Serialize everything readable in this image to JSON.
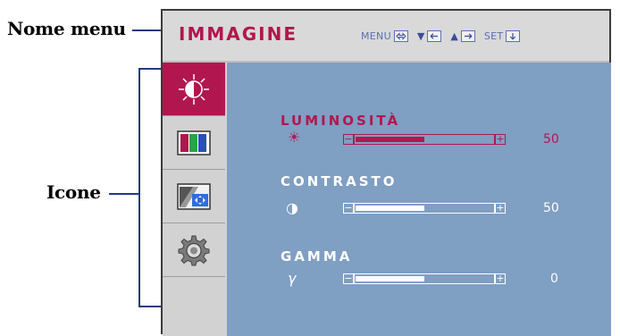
{
  "callouts": {
    "menu_name": "Nome menu",
    "icons": "Icone"
  },
  "header": {
    "title": "IMMAGINE",
    "hints": [
      {
        "label": "MENU",
        "key_icon": "menu-key-icon"
      },
      {
        "label": "",
        "symbol": "▼",
        "key_icon": "left-arrow-key-icon"
      },
      {
        "label": "",
        "symbol": "▲",
        "key_icon": "right-arrow-key-icon"
      },
      {
        "label": "SET",
        "key_icon": "down-arrow-key-icon"
      }
    ]
  },
  "sidebar": {
    "items": [
      {
        "icon": "brightness-contrast-icon",
        "active": true
      },
      {
        "icon": "color-bars-icon",
        "active": false
      },
      {
        "icon": "picture-position-icon",
        "active": false
      },
      {
        "icon": "gear-icon",
        "active": false
      }
    ]
  },
  "settings": [
    {
      "label": "LUMINOSITÀ",
      "symbol": "☀",
      "value": "50",
      "fill": 0.5,
      "active": true
    },
    {
      "label": "CONTRASTO",
      "symbol": "◑",
      "value": "50",
      "fill": 0.5,
      "active": false
    },
    {
      "label": "GAMMA",
      "symbol": "γ",
      "value": "0",
      "fill": 0.5,
      "active": false
    }
  ],
  "colors": {
    "accent": "#b2164f",
    "panel": "#7f9fc3",
    "frame": "#d8d8d8"
  }
}
